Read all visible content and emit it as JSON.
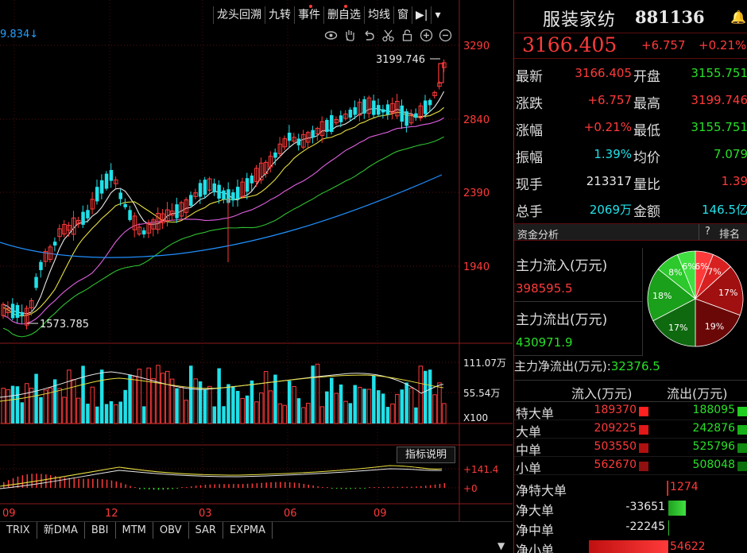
{
  "toolbar": {
    "items": [
      "龙头回溯",
      "九转",
      "事件",
      "删自选",
      "均线",
      "窗"
    ],
    "pin_icon": "pin-right-icon",
    "menu_icon": "dropdown-icon"
  },
  "ma_readout": "9.834↓",
  "chart_icons": [
    "eye-icon",
    "hand-icon",
    "undo-icon",
    "scissors-icon",
    "lock-icon",
    "zoom-in-icon",
    "zoom-out-icon"
  ],
  "price_axis": [
    "3290",
    "2840",
    "2390",
    "1940"
  ],
  "high_label": "3199.746",
  "low_label": "1573.785",
  "volume_axis": [
    "111.07万",
    "55.54万",
    "X100"
  ],
  "indicator_button": "指标说明",
  "indicator_axis": [
    "+141.4",
    "+0"
  ],
  "month_labels": [
    "09",
    "12",
    "03",
    "06",
    "09"
  ],
  "bottom_tabs": [
    "TRIX",
    "新DMA",
    "BBI",
    "MTM",
    "OBV",
    "SAR",
    "EXPMA"
  ],
  "colors": {
    "up": "#ff3a3a",
    "down": "#20e0e8",
    "ma5": "#e8e8e8",
    "ma10": "#e8e040",
    "ma20": "#e060e0",
    "ma30": "#30c030",
    "ma60": "#2090ff"
  },
  "stock": {
    "name": "服装家纺",
    "code": "881136",
    "price": "3166.405",
    "change": "+6.757",
    "change_pct": "+0.21%"
  },
  "quote": [
    {
      "l1": "最新",
      "v1": "3166.405",
      "c1": "red",
      "l2": "开盘",
      "v2": "3155.751",
      "c2": "green"
    },
    {
      "l1": "涨跌",
      "v1": "+6.757",
      "c1": "red",
      "l2": "最高",
      "v2": "3199.746",
      "c2": "red"
    },
    {
      "l1": "涨幅",
      "v1": "+0.21%",
      "c1": "red",
      "l2": "最低",
      "v2": "3155.751",
      "c2": "green"
    },
    {
      "l1": "振幅",
      "v1": "1.39%",
      "c1": "cyan",
      "l2": "均价",
      "v2": "7.079",
      "c2": "green"
    },
    {
      "l1": "现手",
      "v1": "213317",
      "c1": "white",
      "l2": "量比",
      "v2": "1.39",
      "c2": "red"
    },
    {
      "l1": "总手",
      "v1": "2069万",
      "c1": "cyan",
      "l2": "金额",
      "v2": "146.5亿",
      "c2": "cyan"
    }
  ],
  "fund": {
    "title": "资金分析",
    "help": "?",
    "rank": "排名",
    "inflow_label": "主力流入(万元)",
    "inflow_value": "398595.5",
    "outflow_label": "主力流出(万元)",
    "outflow_value": "430971.9",
    "net_label": "主力净流出(万元):",
    "net_value": "32376.5",
    "pie": [
      {
        "label": "6%",
        "value": 6,
        "color": "#ff3a3a"
      },
      {
        "label": "7%",
        "value": 7,
        "color": "#d82020"
      },
      {
        "label": "17%",
        "value": 17,
        "color": "#a01010"
      },
      {
        "label": "19%",
        "value": 19,
        "color": "#6a0808"
      },
      {
        "label": "17%",
        "value": 17,
        "color": "#0f6a0f"
      },
      {
        "label": "18%",
        "value": 18,
        "color": "#1aa01a"
      },
      {
        "label": "8%",
        "value": 8,
        "color": "#2cc82c"
      },
      {
        "label": "6%",
        "value": 6,
        "color": "#40e040"
      }
    ]
  },
  "orders": {
    "col_in": "流入(万元)",
    "col_out": "流出(万元)",
    "rows": [
      {
        "name": "特大单",
        "in": "189370",
        "out": "188095"
      },
      {
        "name": "大单",
        "in": "209225",
        "out": "242876"
      },
      {
        "name": "中单",
        "in": "503550",
        "out": "525796"
      },
      {
        "name": "小单",
        "in": "562670",
        "out": "508048"
      }
    ]
  },
  "net_orders": [
    {
      "name": "净特大单",
      "value": "1274",
      "sign": "pos"
    },
    {
      "name": "净大单",
      "value": "-33651",
      "sign": "neg"
    },
    {
      "name": "净中单",
      "value": "-22245",
      "sign": "neg"
    },
    {
      "name": "净小单",
      "value": "54622",
      "sign": "pos"
    }
  ]
}
